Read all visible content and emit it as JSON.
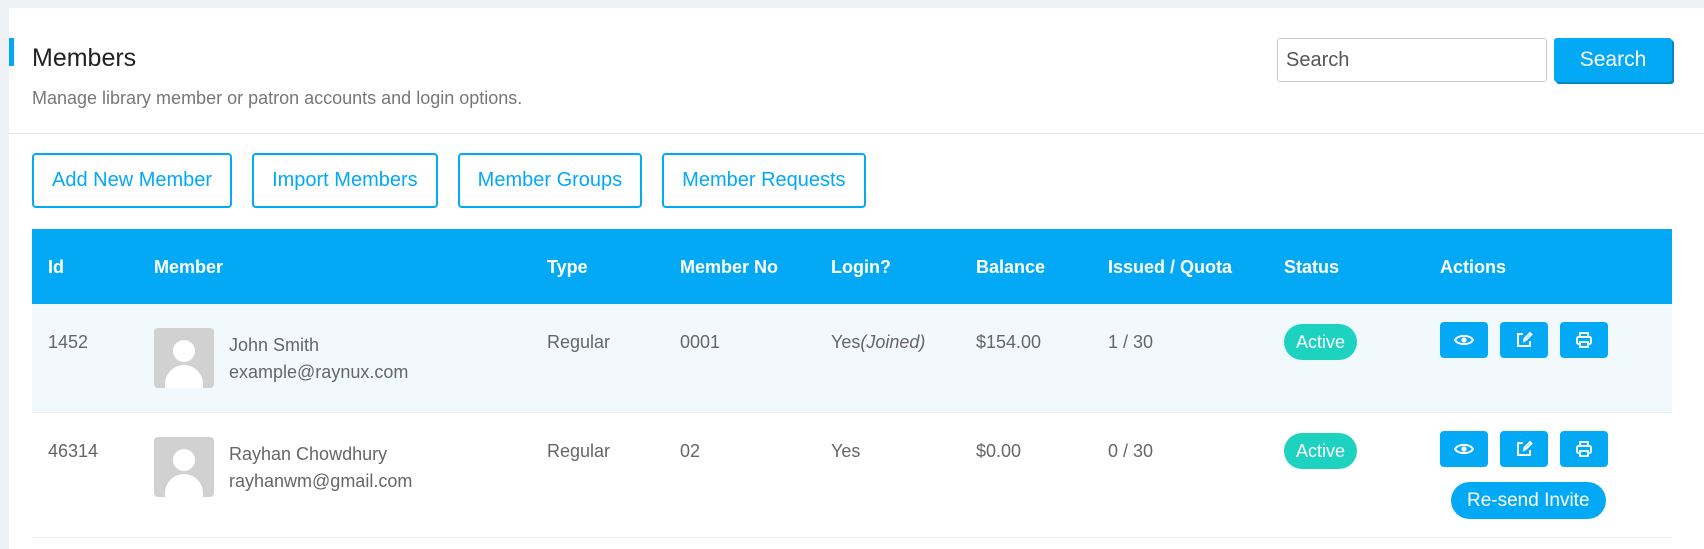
{
  "header": {
    "title": "Members",
    "subtitle": "Manage library member or patron accounts and login options.",
    "search_placeholder": "Search",
    "search_button": "Search"
  },
  "toolbar": {
    "add_new_member": "Add New Member",
    "import_members": "Import Members",
    "member_groups": "Member Groups",
    "member_requests": "Member Requests"
  },
  "table": {
    "columns": [
      "Id",
      "Member",
      "Type",
      "Member No",
      "Login?",
      "Balance",
      "Issued / Quota",
      "Status",
      "Actions"
    ],
    "rows": [
      {
        "id": "1452",
        "name": "John Smith",
        "email": "example@raynux.com",
        "type": "Regular",
        "member_no": "0001",
        "login": "Yes",
        "login_note": "(Joined)",
        "balance": "$154.00",
        "issued_quota": "1 / 30",
        "status": "Active"
      },
      {
        "id": "46314",
        "name": "Rayhan Chowdhury",
        "email": "rayhanwm@gmail.com",
        "type": "Regular",
        "member_no": "02",
        "login": "Yes",
        "login_note": "",
        "balance": "$0.00",
        "issued_quota": "0 / 30",
        "status": "Active",
        "resend_invite": "Re-send Invite"
      }
    ]
  },
  "icons": {
    "view": "eye-icon",
    "edit": "edit-icon",
    "print": "printer-icon",
    "avatar": "user-avatar-placeholder"
  },
  "colors": {
    "accent": "#03a9f4",
    "status_active": "#1dd3c0",
    "row_alt": "#f2f9fc"
  }
}
